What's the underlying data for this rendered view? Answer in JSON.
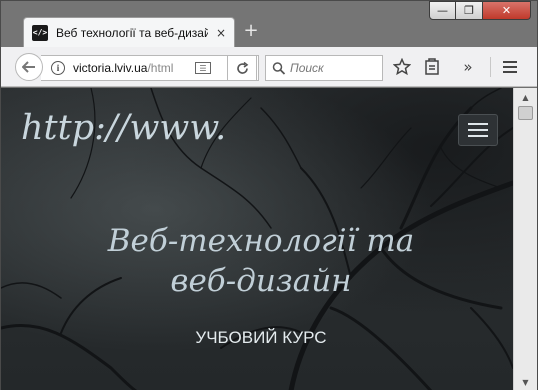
{
  "tab": {
    "favicon_text": "</>",
    "title": "Веб технології та веб-дизайн",
    "close": "×"
  },
  "newtab_label": "+",
  "window_controls": {
    "minimize": "—",
    "maximize": "❐",
    "close": "✕"
  },
  "navbar": {
    "url_host": "victoria.lviv.ua",
    "url_path": "/html",
    "search_placeholder": "Поиск",
    "overflow": "»"
  },
  "page": {
    "logo": "http://www.",
    "hero_title_line1": "Веб-технології та",
    "hero_title_line2": "веб-дизайн",
    "hero_subtitle": "УЧБОВИЙ КУРС"
  },
  "icons": [
    "info-icon",
    "reader-icon",
    "reload-icon",
    "search-icon",
    "bookmark-star-icon",
    "library-icon",
    "overflow-icon",
    "hamburger-menu-icon"
  ]
}
